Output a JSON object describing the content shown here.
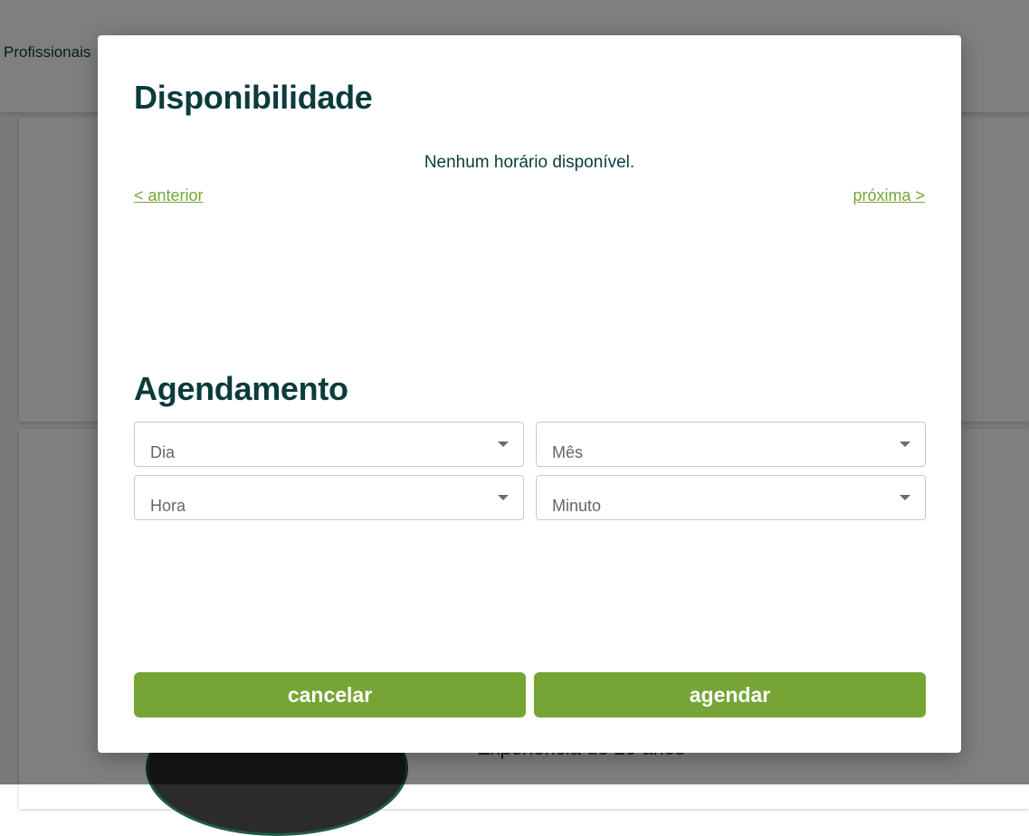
{
  "background": {
    "nav_item": "Profissionais",
    "card_subtitle": "Experiência de 20 anos"
  },
  "modal": {
    "availability_title": "Disponibilidade",
    "empty_message": "Nenhum horário disponível.",
    "prev_label": "< anterior",
    "next_label": "próxima >",
    "scheduling_title": "Agendamento",
    "selects": {
      "day": "Dia",
      "month": "Mês",
      "hour": "Hora",
      "minute": "Minuto"
    },
    "cancel_label": "cancelar",
    "submit_label": "agendar"
  },
  "colors": {
    "accent": "#76a535",
    "heading": "#0b3b3b",
    "backdrop": "rgba(0,0,0,0.5)"
  },
  "icons": {
    "select_arrow": "caret-down-icon"
  }
}
